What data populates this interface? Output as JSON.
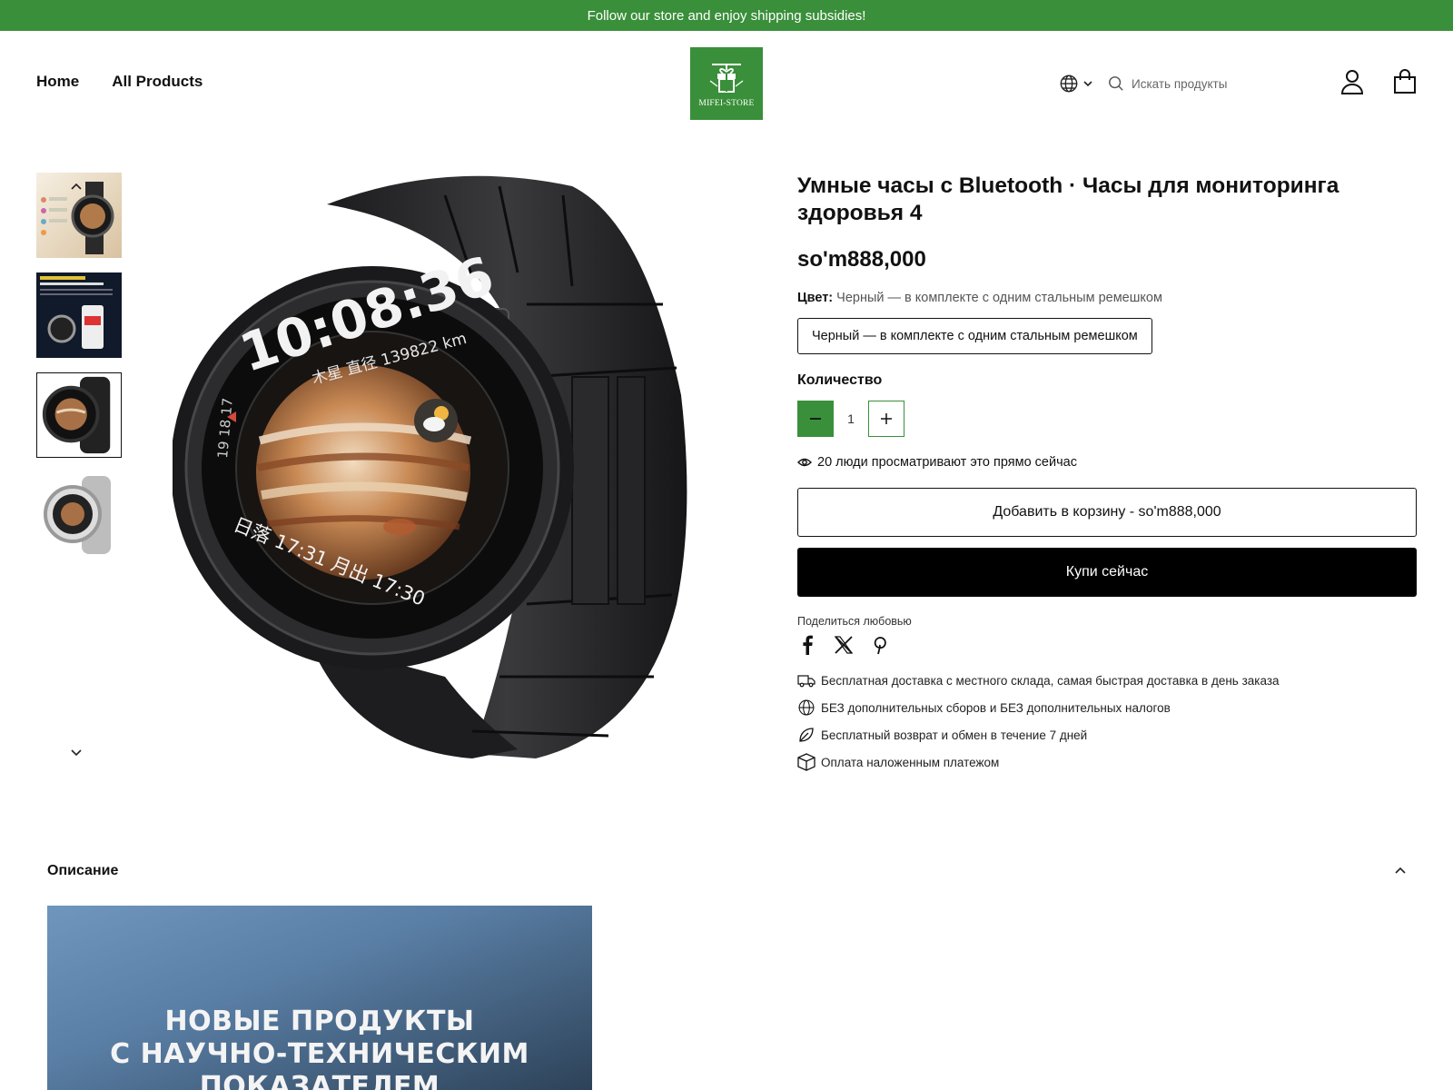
{
  "announcement": "Follow our store and enjoy shipping subsidies!",
  "nav": {
    "home": "Home",
    "all_products": "All Products"
  },
  "logo": {
    "text": "MIFEI-STORE"
  },
  "search": {
    "placeholder": "Искать продукты"
  },
  "icons": {
    "language": "globe-icon",
    "search": "search-icon",
    "account": "user-icon",
    "cart": "shopping-bag-icon"
  },
  "gallery": {
    "thumbnails": [
      {
        "alt": "watch feature overview"
      },
      {
        "alt": "health monitoring infographic"
      },
      {
        "alt": "black steel strap watch"
      },
      {
        "alt": "silver steel strap watch"
      }
    ],
    "active_index": 2,
    "watch_face": {
      "time": "10:08:36",
      "sub": "木星 直径 139822 km",
      "bottom": "日落 17:31  月出 17:30",
      "scale": "19 18 17"
    }
  },
  "product": {
    "title": "Умные часы с Bluetooth · Часы для мониторинга здоровья 4",
    "price": "so'm888,000",
    "color_label": "Цвет:",
    "color_value": "Черный — в комплекте с одним стальным ремешком",
    "variant": "Черный — в комплекте с одним стальным ремешком",
    "quantity_label": "Количество",
    "quantity": "1",
    "viewers": "20 люди просматривают это прямо сейчас",
    "add_to_cart": "Добавить в корзину  -  so'm888,000",
    "buy_now": "Купи сейчас",
    "share_label": "Поделиться любовью",
    "features": [
      "Бесплатная доставка с местного склада, самая быстрая доставка в день заказа",
      "БЕЗ дополнительных сборов и БЕЗ дополнительных налогов",
      "Бесплатный возврат и обмен в течение 7 дней",
      "Оплата наложенным платежом"
    ]
  },
  "description": {
    "title": "Описание",
    "banner_lines": [
      "НОВЫЕ ПРОДУКТЫ",
      "С НАУЧНО-ТЕХНИЧЕСКИМ",
      "ПОКАЗАТЕЛЕМ"
    ]
  },
  "colors": {
    "brand_green": "#3a8f3a",
    "black": "#000000"
  }
}
